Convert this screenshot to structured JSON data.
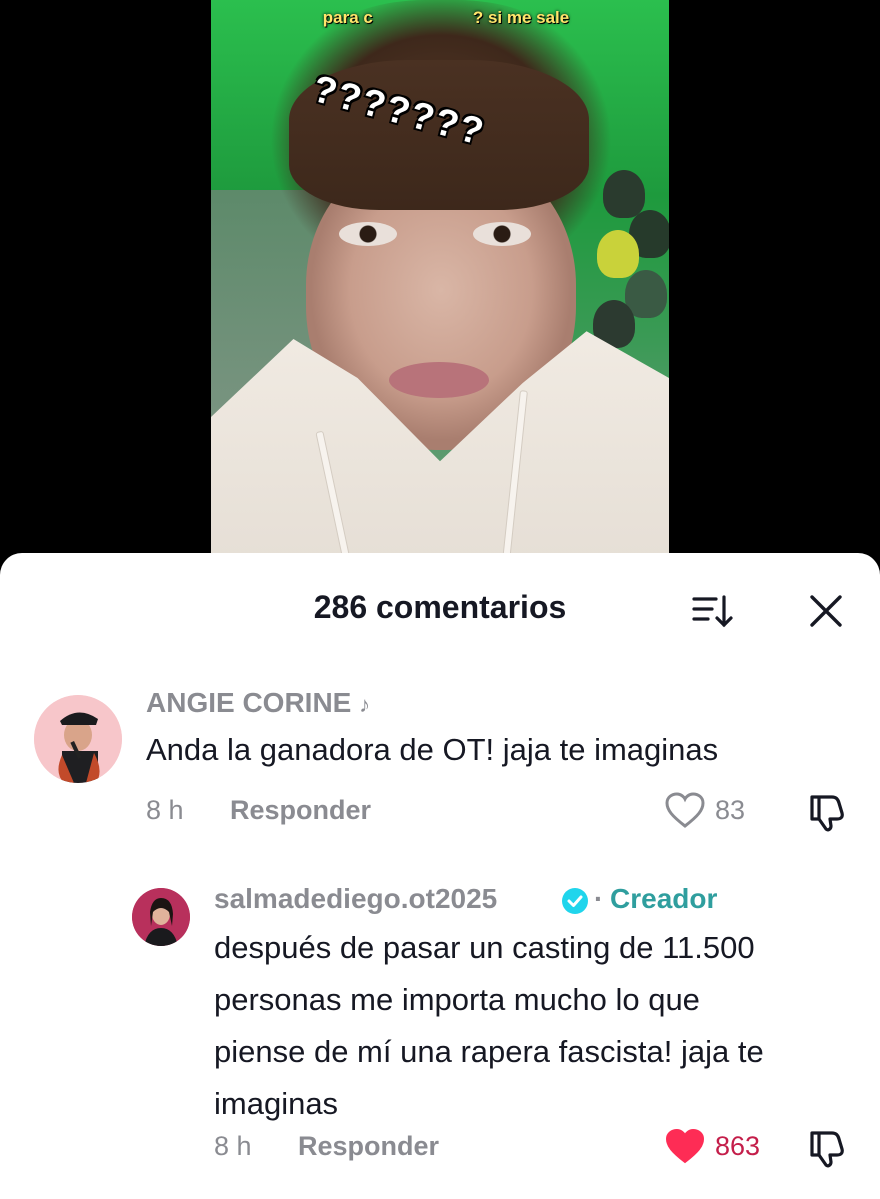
{
  "video": {
    "caption_visible_start": "para c",
    "caption_visible_end": "? si me sale",
    "overlay_text": "???????"
  },
  "comments_sheet": {
    "title": "286 comentarios",
    "comments": [
      {
        "username": "ANGIE CORINE",
        "username_suffix": "♪",
        "text": "Anda la ganadora de OT! jaja te imaginas",
        "time": "8 h",
        "reply_label": "Responder",
        "likes": "83",
        "liked": false
      },
      {
        "username": "salmadediego.ot2025",
        "badge": "verified",
        "separator": "·",
        "role": "Creador",
        "text_lines": [
          "después de pasar un casting de 11.500",
          "personas me importa mucho lo que",
          "piense de mí una rapera fascista! jaja te",
          "imaginas"
        ],
        "time": "8 h",
        "reply_label": "Responder",
        "likes": "863",
        "liked": true
      }
    ]
  },
  "colors": {
    "text_primary": "#161823",
    "text_secondary": "#8a8b91",
    "liked_heart": "#fe2c55",
    "creator_label": "#2f9e9e",
    "verified_badge": "#20d5ec"
  },
  "icons": [
    "sort-icon",
    "close-icon",
    "heart-icon",
    "dislike-icon",
    "verified-badge-icon"
  ]
}
